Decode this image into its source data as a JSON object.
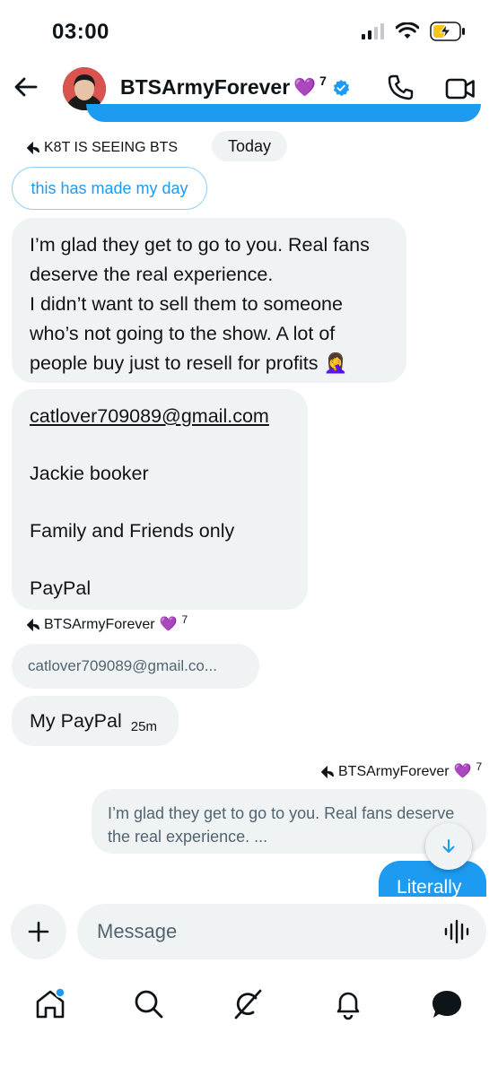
{
  "status_bar": {
    "time": "03:00",
    "icons": [
      "cellular-signal-icon",
      "wifi-icon",
      "battery-charging-icon"
    ]
  },
  "header": {
    "name": "BTSArmyForever",
    "name_suffix_emoji": "💜",
    "superscript": "7",
    "icons": [
      "back-arrow-icon",
      "verified-badge-icon",
      "phone-icon",
      "video-icon"
    ]
  },
  "conversation": {
    "reply_label_1": "K8T IS SEEING BTS",
    "date_separator": "Today",
    "quoted_message_1": "this has made my day",
    "message_1_lines": [
      "I’m glad they get to go to you. Real fans",
      "deserve the real experience.",
      "I didn’t want to sell them to someone",
      "who’s not going to the show. A lot of",
      "people buy just to resell for profits 🤦‍♀️"
    ],
    "message_2": {
      "email": "catlover709089@gmail.com",
      "name": "Jackie booker",
      "payment_type": "Family and Friends only",
      "method": "PayPal"
    },
    "reply_label_2": "BTSArmyForever",
    "reply_label_2_emoji": "💜",
    "reply_label_2_sup": "7",
    "quoted_message_2": "catlover709089@gmail.co...",
    "message_3": "My PayPal",
    "message_3_time": "25m",
    "reply_label_3": "BTSArmyForever",
    "reply_label_3_emoji": "💜",
    "reply_label_3_sup": "7",
    "quoted_message_3": "I’m glad they get to go to you. Real fans deserve the real experience. ...",
    "message_4_partial": "Literally"
  },
  "composer": {
    "placeholder": "Message",
    "icons": [
      "plus-icon",
      "voice-waveform-icon"
    ]
  },
  "bottom_nav": {
    "items": [
      "home-icon",
      "search-icon",
      "grok-icon",
      "notifications-icon",
      "messages-icon"
    ],
    "home_has_badge": true
  },
  "colors": {
    "accent": "#1d9bf0",
    "bubble_grey": "#eff3f4",
    "text_primary": "#0f1419",
    "text_secondary": "#536471",
    "heart": "#9b3ff0",
    "battery_charging": "#f5c518"
  }
}
